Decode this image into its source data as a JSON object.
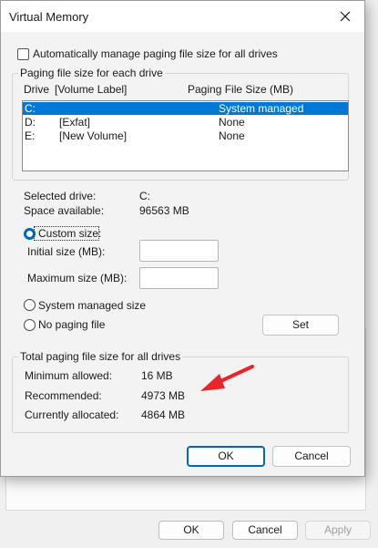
{
  "dialog": {
    "title": "Virtual Memory",
    "auto_manage_label": "Automatically manage paging file size for all drives",
    "auto_manage_checked": false,
    "paging_group_label": "Paging file size for each drive",
    "list": {
      "col_drive": "Drive",
      "col_volume": "[Volume Label]",
      "col_size": "Paging File Size (MB)",
      "rows": [
        {
          "drive": "C:",
          "label": "",
          "size": "System managed",
          "selected": true
        },
        {
          "drive": "D:",
          "label": "[Exfat]",
          "size": "None",
          "selected": false
        },
        {
          "drive": "E:",
          "label": "[New Volume]",
          "size": "None",
          "selected": false
        }
      ]
    },
    "selected_drive_label": "Selected drive:",
    "selected_drive_value": "C:",
    "space_label": "Space available:",
    "space_value": "96563 MB",
    "custom_size_label": "Custom size:",
    "initial_size_label": "Initial size (MB):",
    "initial_size_value": "",
    "max_size_label": "Maximum size (MB):",
    "max_size_value": "",
    "system_managed_label": "System managed size",
    "no_paging_label": "No paging file",
    "set_label": "Set",
    "total_group_label": "Total paging file size for all drives",
    "min_allowed_label": "Minimum allowed:",
    "min_allowed_value": "16 MB",
    "recommended_label": "Recommended:",
    "recommended_value": "4973 MB",
    "allocated_label": "Currently allocated:",
    "allocated_value": "4864 MB",
    "ok_label": "OK",
    "cancel_label": "Cancel"
  },
  "background": {
    "ok_label": "OK",
    "cancel_label": "Cancel",
    "apply_label": "Apply"
  },
  "colors": {
    "accent": "#0067c0",
    "selection": "#0078d7",
    "annotation_arrow": "#e8262a"
  }
}
